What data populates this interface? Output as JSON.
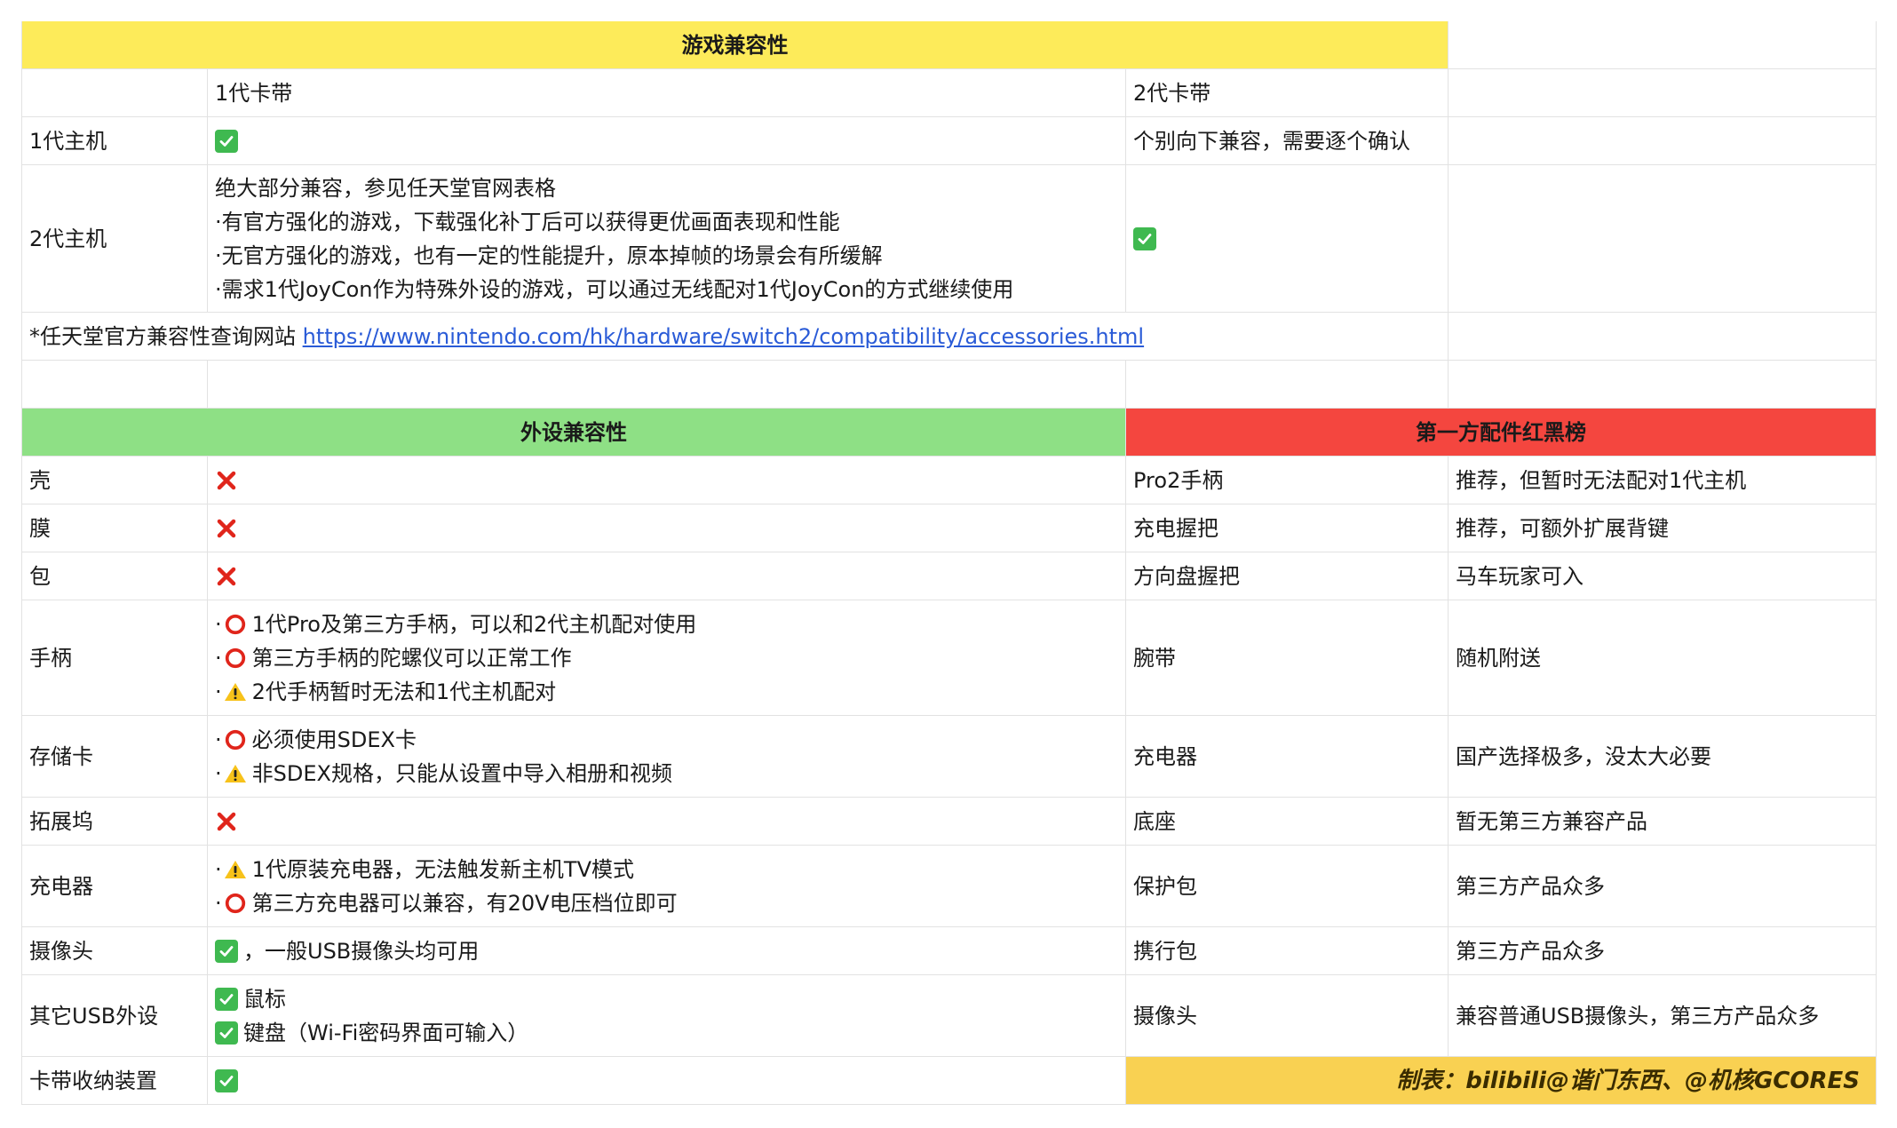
{
  "game_compat": {
    "header": "游戏兼容性",
    "col_gen1_cart": "1代卡带",
    "col_gen2_cart": "2代卡带",
    "row_gen1_console": {
      "label": "1代主机",
      "gen2_cart": "个别向下兼容，需要逐个确认"
    },
    "row_gen2_console": {
      "label": "2代主机",
      "gen1_cart_lines": [
        "绝大部分兼容，参见任天堂官网表格",
        "·有官方强化的游戏，下载强化补丁后可以获得更优画面表现和性能",
        "·无官方强化的游戏，也有一定的性能提升，原本掉帧的场景会有所缓解",
        "·需求1代JoyCon作为特殊外设的游戏，可以通过无线配对1代JoyCon的方式继续使用"
      ]
    },
    "note_prefix": "*任天堂官方兼容性查询网站 ",
    "note_url": "https://www.nintendo.com/hk/hardware/switch2/compatibility/accessories.html"
  },
  "peripheral_compat": {
    "header": "外设兼容性",
    "rows": [
      {
        "label": "壳"
      },
      {
        "label": "膜"
      },
      {
        "label": "包"
      },
      {
        "label": "手柄",
        "lines": [
          "1代Pro及第三方手柄，可以和2代主机配对使用",
          "第三方手柄的陀螺仪可以正常工作",
          "2代手柄暂时无法和1代主机配对"
        ]
      },
      {
        "label": "存储卡",
        "lines": [
          "必须使用SDEX卡",
          "非SDEX规格，只能从设置中导入相册和视频"
        ]
      },
      {
        "label": "拓展坞"
      },
      {
        "label": "充电器",
        "lines": [
          "1代原装充电器，无法触发新主机TV模式",
          "第三方充电器可以兼容，有20V电压档位即可"
        ]
      },
      {
        "label": "摄像头",
        "text": "，一般USB摄像头均可用"
      },
      {
        "label": "其它USB外设",
        "lines": [
          "鼠标",
          "键盘（Wi-Fi密码界面可输入）"
        ]
      },
      {
        "label": "卡带收纳装置"
      }
    ]
  },
  "third_party": {
    "header": "第一方配件红黑榜",
    "rows": [
      {
        "item": "Pro2手柄",
        "comment": "推荐，但暂时无法配对1代主机"
      },
      {
        "item": "充电握把",
        "comment": "推荐，可额外扩展背键"
      },
      {
        "item": "方向盘握把",
        "comment": "马车玩家可入"
      },
      {
        "item": "腕带",
        "comment": "随机附送"
      },
      {
        "item": "充电器",
        "comment": "国产选择极多，没太大必要"
      },
      {
        "item": "底座",
        "comment": "暂无第三方兼容产品"
      },
      {
        "item": "保护包",
        "comment": "第三方产品众多"
      },
      {
        "item": "携行包",
        "comment": "第三方产品众多"
      },
      {
        "item": "摄像头",
        "comment": "兼容普通USB摄像头，第三方产品众多"
      }
    ],
    "credit": "制表：bilibili@谐门东西、@机核GCORES"
  },
  "colors": {
    "yellow_header": "#fdeb5a",
    "green_header": "#8ee085",
    "red_header": "#f4463f",
    "credit_bg": "#f9d152",
    "check_green": "#3fb950",
    "cross_red": "#e0251b",
    "circle_red": "#e0251b",
    "warning_yellow": "#f7c21a",
    "link_blue": "#2a5bd7"
  },
  "icons": {
    "check": "check-mark-icon",
    "cross": "cross-mark-icon",
    "circle": "red-circle-icon",
    "warning": "warning-icon"
  }
}
